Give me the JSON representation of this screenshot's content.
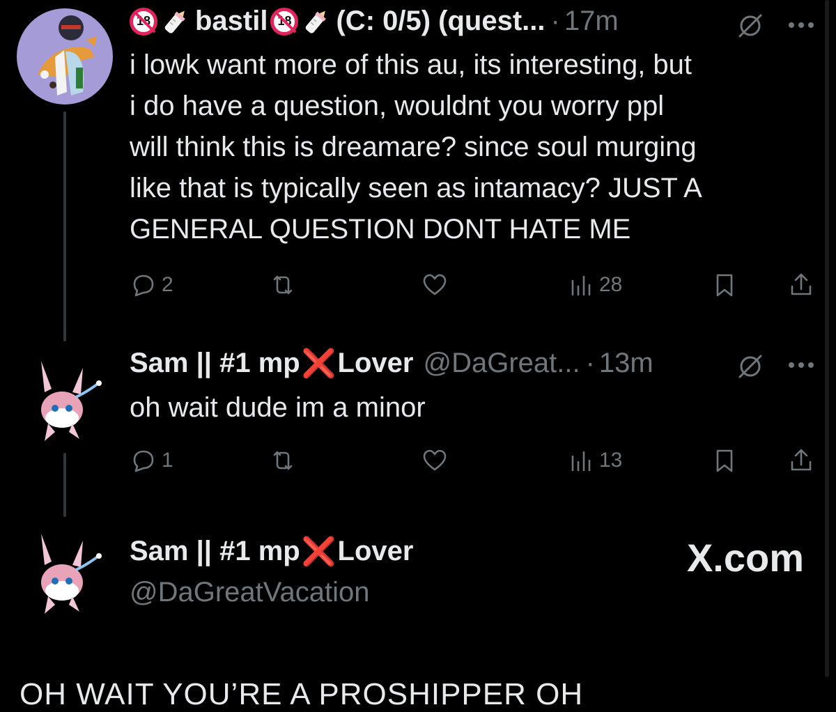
{
  "tweets": [
    {
      "name": "bastil",
      "name_suffix": "(C: 0/5) (quest...",
      "time": "17m",
      "text": "i lowk want more of this au, its interesting, but\ni do have a question, wouldnt you worry ppl\nwill think this is dreamare? since soul murging\nlike that is typically seen as intamacy? JUST A\nGENERAL QUESTION DONT HATE ME",
      "replies": "2",
      "views": "28"
    },
    {
      "name_a": "Sam || #1 mp",
      "name_b": "Lover",
      "handle": "@DaGreat...",
      "time": "13m",
      "text": "oh wait dude im a minor",
      "replies": "1",
      "views": "13"
    }
  ],
  "quoted_profile": {
    "name_a": "Sam || #1 mp",
    "name_b": "Lover",
    "handle": "@DaGreatVacation"
  },
  "watermark": "X.com",
  "caption": "OH WAIT YOU’RE A PROSHIPPER OH",
  "emoji": {
    "eighteen": "18",
    "cross": "❌"
  },
  "colors": {
    "background": "#000000",
    "text": "#e7e9ea",
    "muted": "#71767b",
    "accent": "#e0245e"
  }
}
